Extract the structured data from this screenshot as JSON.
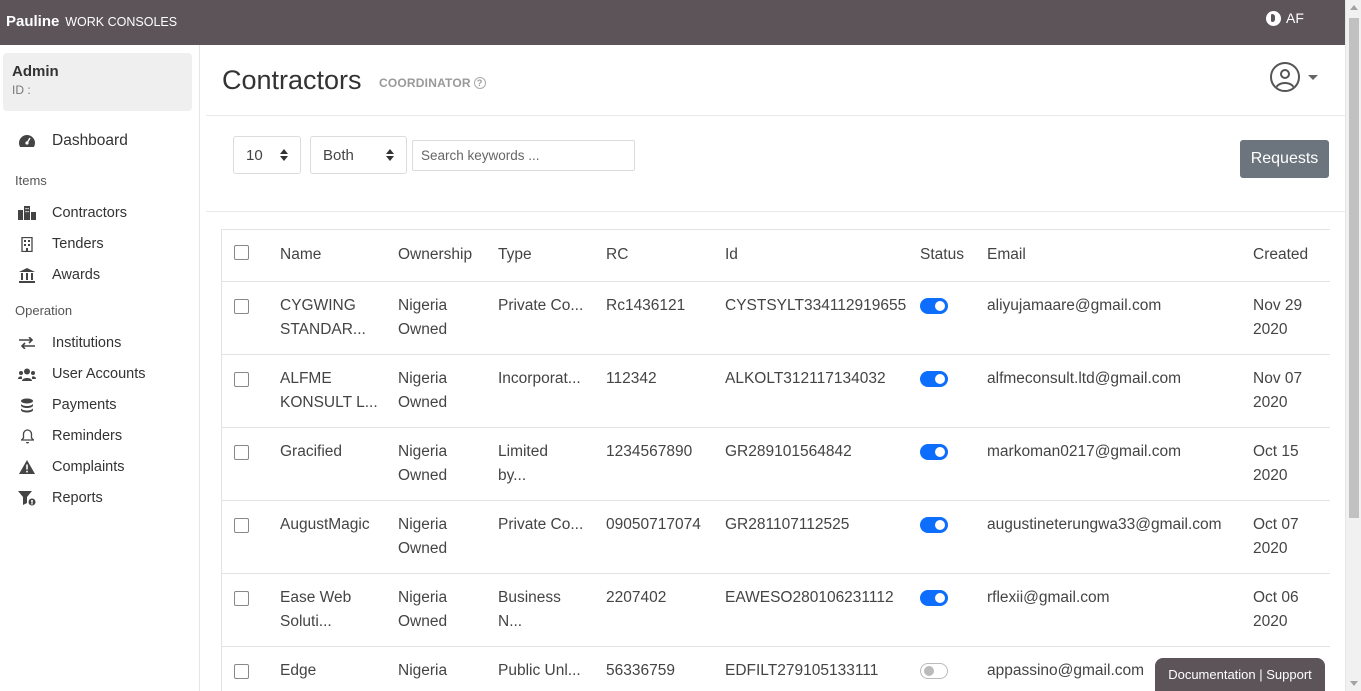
{
  "topbar": {
    "brand": "Pauline",
    "brand_sub": "WORK CONSOLES",
    "lang": "AF"
  },
  "user": {
    "name": "Admin",
    "id_label": "ID :"
  },
  "sidebar": {
    "dashboard": "Dashboard",
    "section_items": "Items",
    "items": [
      {
        "label": "Contractors",
        "icon": "city-icon"
      },
      {
        "label": "Tenders",
        "icon": "building-icon"
      },
      {
        "label": "Awards",
        "icon": "landmark-icon"
      }
    ],
    "section_operation": "Operation",
    "operation": [
      {
        "label": "Institutions",
        "icon": "exchange-icon"
      },
      {
        "label": "User Accounts",
        "icon": "users-icon"
      },
      {
        "label": "Payments",
        "icon": "coins-icon"
      },
      {
        "label": "Reminders",
        "icon": "bell-icon"
      },
      {
        "label": "Complaints",
        "icon": "warning-icon"
      },
      {
        "label": "Reports",
        "icon": "filter-icon"
      }
    ]
  },
  "header": {
    "title": "Contractors",
    "role": "COORDINATOR"
  },
  "filters": {
    "page_size": "10",
    "scope": "Both",
    "search_placeholder": "Search keywords ...",
    "requests_label": "Requests"
  },
  "table": {
    "columns": [
      "Name",
      "Ownership",
      "Type",
      "RC",
      "Id",
      "Status",
      "Email",
      "Created"
    ],
    "rows": [
      {
        "name": [
          "CYGWING",
          "STANDAR..."
        ],
        "ownership": [
          "Nigeria",
          "Owned"
        ],
        "type": [
          "Private Co..."
        ],
        "rc": "Rc1436121",
        "id": "CYSTSYLT334112919655",
        "status": true,
        "email": "aliyujamaare@gmail.com",
        "created": [
          "Nov 29",
          "2020"
        ]
      },
      {
        "name": [
          "ALFME",
          "KONSULT L..."
        ],
        "ownership": [
          "Nigeria",
          "Owned"
        ],
        "type": [
          "Incorporat..."
        ],
        "rc": "112342",
        "id": "ALKOLT312117134032",
        "status": true,
        "email": "alfmeconsult.ltd@gmail.com",
        "created": [
          "Nov 07",
          "2020"
        ]
      },
      {
        "name": [
          "Gracified"
        ],
        "ownership": [
          "Nigeria",
          "Owned"
        ],
        "type": [
          "Limited",
          "by..."
        ],
        "rc": "1234567890",
        "id": "GR289101564842",
        "status": true,
        "email": "markoman0217@gmail.com",
        "created": [
          "Oct 15",
          "2020"
        ]
      },
      {
        "name": [
          "AugustMagic"
        ],
        "ownership": [
          "Nigeria",
          "Owned"
        ],
        "type": [
          "Private Co..."
        ],
        "rc": "09050717074",
        "id": "GR281107112525",
        "status": true,
        "email": "augustineterungwa33@gmail.com",
        "created": [
          "Oct 07",
          "2020"
        ]
      },
      {
        "name": [
          "Ease Web",
          "Soluti..."
        ],
        "ownership": [
          "Nigeria",
          "Owned"
        ],
        "type": [
          "Business",
          "N..."
        ],
        "rc": "2207402",
        "id": "EAWESO280106231112",
        "status": true,
        "email": "rflexii@gmail.com",
        "created": [
          "Oct 06",
          "2020"
        ]
      },
      {
        "name": [
          "Edge"
        ],
        "ownership": [
          "Nigeria"
        ],
        "type": [
          "Public Unl..."
        ],
        "rc": "56336759",
        "id": "EDFILT279105133111",
        "status": false,
        "email": "appassino@gmail.com",
        "created": [
          ""
        ]
      }
    ]
  },
  "footer": {
    "support": "Documentation | Support"
  },
  "colors": {
    "topbar": "#5d5459",
    "toggle_on": "#0d6efd",
    "button": "#6c757d"
  }
}
